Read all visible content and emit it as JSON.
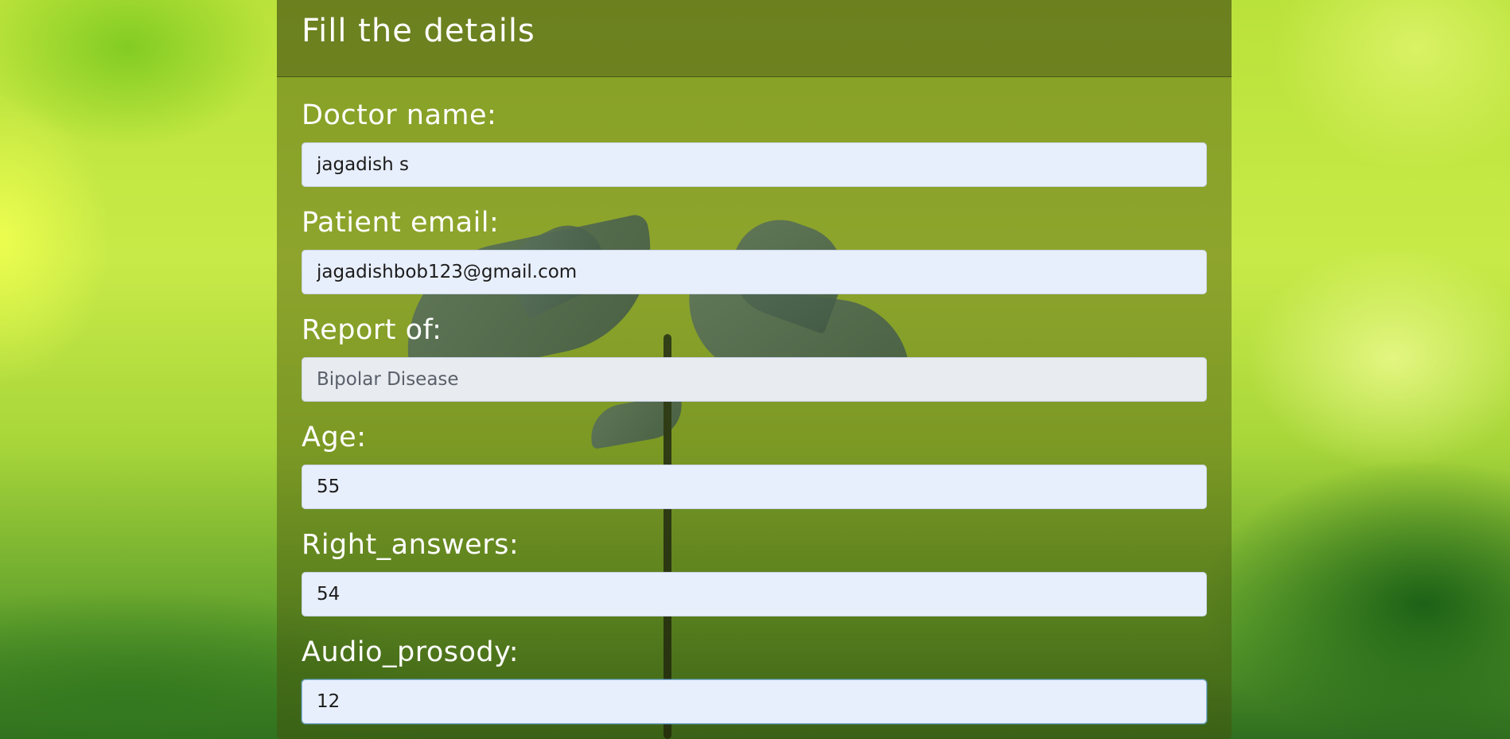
{
  "form": {
    "title": "Fill the details",
    "fields": [
      {
        "label": "Doctor name:",
        "value": "jagadish s"
      },
      {
        "label": "Patient email:",
        "value": "jagadishbob123@gmail.com"
      },
      {
        "label": "Report of:",
        "value": "Bipolar Disease",
        "readonly": true
      },
      {
        "label": "Age:",
        "value": "55"
      },
      {
        "label": "Right_answers:",
        "value": "54"
      },
      {
        "label": "Audio_prosody:",
        "value": "12"
      }
    ]
  },
  "colors": {
    "panel_overlay": "#46500a",
    "input_bg": "#e8effc",
    "input_readonly_bg": "#e8ebf0",
    "label_text": "#ffffff"
  }
}
